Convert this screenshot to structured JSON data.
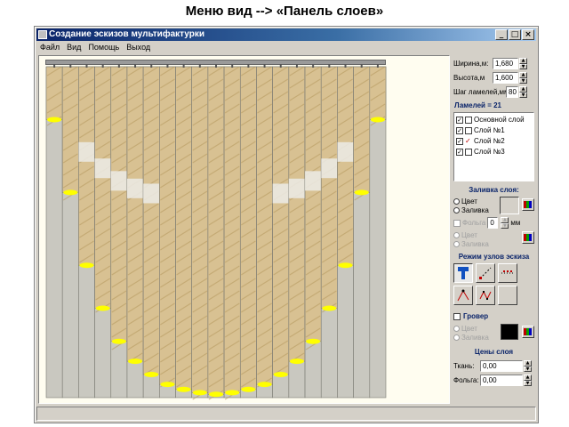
{
  "slide": {
    "title": "Меню вид --> «Панель слоев»"
  },
  "window": {
    "title": "Создание эскизов мультифактурки",
    "controls": {
      "minimize": "_",
      "maximize": "□",
      "close": "×"
    }
  },
  "menu": {
    "items": [
      "Файл",
      "Вид",
      "Помощь",
      "Выход"
    ]
  },
  "panel": {
    "width_label": "Ширина,м:",
    "width_value": "1,680",
    "height_label": "Высота,м",
    "height_value": "1,600",
    "step_label": "Шаг ламелей,мм",
    "step_value": "80",
    "lamels_label": "Ламелей = 21",
    "layers": [
      {
        "name": "Основной слой",
        "checked": true,
        "color": "#000000"
      },
      {
        "name": "Слой №1",
        "checked": true,
        "color": "#000000"
      },
      {
        "name": "Слой №2",
        "checked": true,
        "color": "#c00000"
      },
      {
        "name": "Слой №3",
        "checked": true,
        "color": "#000000"
      }
    ],
    "fill_title": "Заливка слоя:",
    "fill_color": "Цвет",
    "fill_fill": "Заливка",
    "foil_label": "Фольга",
    "foil_value": "0",
    "foil_unit": "мм",
    "foil_color": "Цвет",
    "foil_fill": "Заливка",
    "mode_title": "Режим узлов эскиза",
    "tools": [
      "pointer-icon",
      "line-icon",
      "dots-icon",
      "curve-icon",
      "node-edit-icon",
      "blank-tool"
    ],
    "grover_label": "Гровер",
    "grover_color": "Цвет",
    "grover_fill": "Заливка",
    "prices_title": "Цены слоя",
    "fabric_label": "Ткань:",
    "fabric_value": "0,00",
    "foil_price_label": "Фольга:",
    "foil_price_value": "0,00"
  },
  "curtain": {
    "lamels": 21,
    "arch_drop": [
      0.16,
      0.38,
      0.6,
      0.73,
      0.83,
      0.89,
      0.93,
      0.96,
      0.975,
      0.985,
      0.99,
      0.985,
      0.975,
      0.96,
      0.93,
      0.89,
      0.83,
      0.73,
      0.6,
      0.38,
      0.16
    ],
    "colors": {
      "beige": "#d8c192",
      "grey": "#c9c8c0",
      "yellow": "#ffff00",
      "lamel_edge": "#7a7a72"
    }
  }
}
